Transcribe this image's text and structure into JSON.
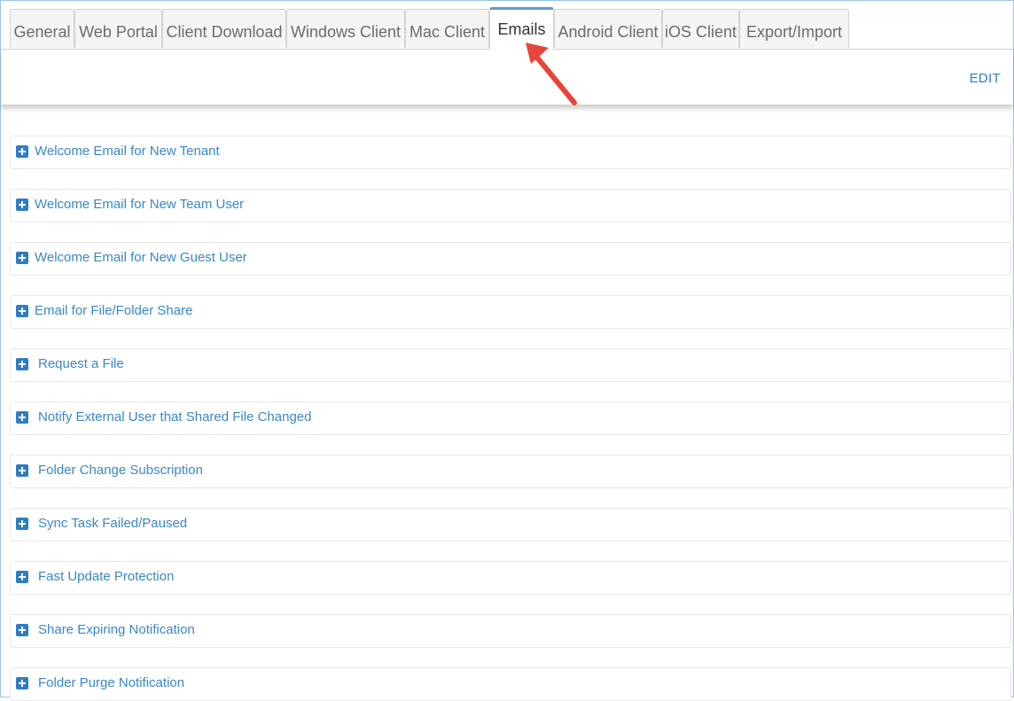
{
  "tabs": [
    {
      "label": "General"
    },
    {
      "label": "Web Portal"
    },
    {
      "label": "Client Download"
    },
    {
      "label": "Windows Client"
    },
    {
      "label": "Mac Client"
    },
    {
      "label": "Emails",
      "active": true
    },
    {
      "label": "Android Client"
    },
    {
      "label": "iOS Client"
    },
    {
      "label": "Export/Import"
    }
  ],
  "toolbar": {
    "edit_label": "EDIT"
  },
  "email_templates": [
    {
      "label": "Welcome Email for New Tenant"
    },
    {
      "label": "Welcome Email for New Team User"
    },
    {
      "label": "Welcome Email for New Guest User"
    },
    {
      "label": "Email for File/Folder Share"
    },
    {
      "label": "Request a File"
    },
    {
      "label": "Notify External User that Shared File Changed"
    },
    {
      "label": "Folder Change Subscription"
    },
    {
      "label": "Sync Task Failed/Paused"
    },
    {
      "label": "Fast Update Protection"
    },
    {
      "label": "Share Expiring Notification"
    },
    {
      "label": "Folder Purge Notification"
    }
  ],
  "colors": {
    "accent": "#2f7dc1",
    "link": "#3a87c8",
    "annotation_arrow": "#e8443a"
  },
  "icons": {
    "expand": "plus-square-icon",
    "pointer": "red-arrow-annotation"
  }
}
